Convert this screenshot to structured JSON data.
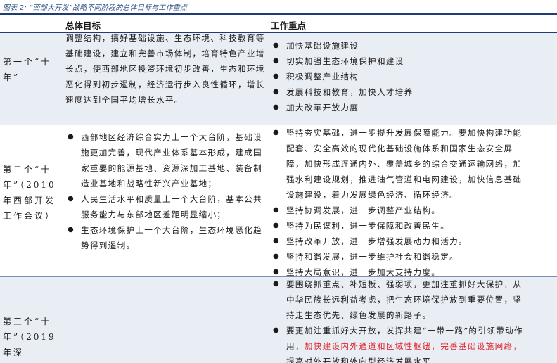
{
  "caption": "图表 2: “西部大开发”战略不同阶段的总体目标与工作重点",
  "headers": {
    "col2": "总体目标",
    "col3": "工作重点"
  },
  "rows": [
    {
      "period": "第一个“十年”",
      "goal": "调整结构，搞好基础设施、生态环境、科技教育等基础建设，建立和完善市场体制，培育特色产业增长点，使西部地区投资环境初步改善，生态和环境恶化得到初步遏制，经济运行步入良性循环，增长速度达到全国平均增长水平。",
      "focus": [
        "加快基础设施建设",
        "切实加强生态环境保护和建设",
        "积极调整产业结构",
        "发展科技和教育，加快人才培养",
        "加大改革开放力度"
      ]
    },
    {
      "period": "第二个“十年”（2010年西部开发工作会议）",
      "goals": [
        "西部地区经济综合实力上一个大台阶，基础设施更加完善，现代产业体系基本形成，建成国家重要的能源基地、资源深加工基地、装备制造业基地和战略性新兴产业基地；",
        "人民生活水平和质量上一个大台阶，基本公共服务能力与东部地区差距明显缩小；",
        "生态环境保护上一个大台阶，生态环境恶化趋势得到遏制。"
      ],
      "focus": [
        "坚持夯实基础，进一步提升发展保障能力。要加快构建功能配套、安全高效的现代化基础设施体系和国家生态安全屏障，加快形成连通内外、覆盖城乡的综合交通运输网络，加强水利建设规划，推进油气管道和电网建设，加快信息基础设施建设，着力发展绿色经济、循环经济。",
        "坚持协调发展，进一步调整产业结构。",
        "坚持为民谋利，进一步保障和改善民生。",
        "坚持改革开放，进一步增强发展动力和活力。",
        "坚持和谐发展，进一步维护社会和谐稳定。",
        "坚持大局意识，进一步加大支持力度。"
      ]
    },
    {
      "period": "第三个“十年”（2019年深",
      "focus_1": "要围绕抓重点、补短板、强弱项，更加注重抓好大保护，从中华民族长远利益考虑，把生态环境保护放到重要位置，坚持走生态优先、绿色发展的新路子。",
      "focus_2_black": "要更加注重抓好大开放，发挥共建“一带一路”的引领带动作用，",
      "focus_2_red": "加快建设内外通道和区域性枢纽，完善基础设施网络，",
      "focus_2_tail": "提高对外开放和外向型经济发展水平"
    }
  ]
}
